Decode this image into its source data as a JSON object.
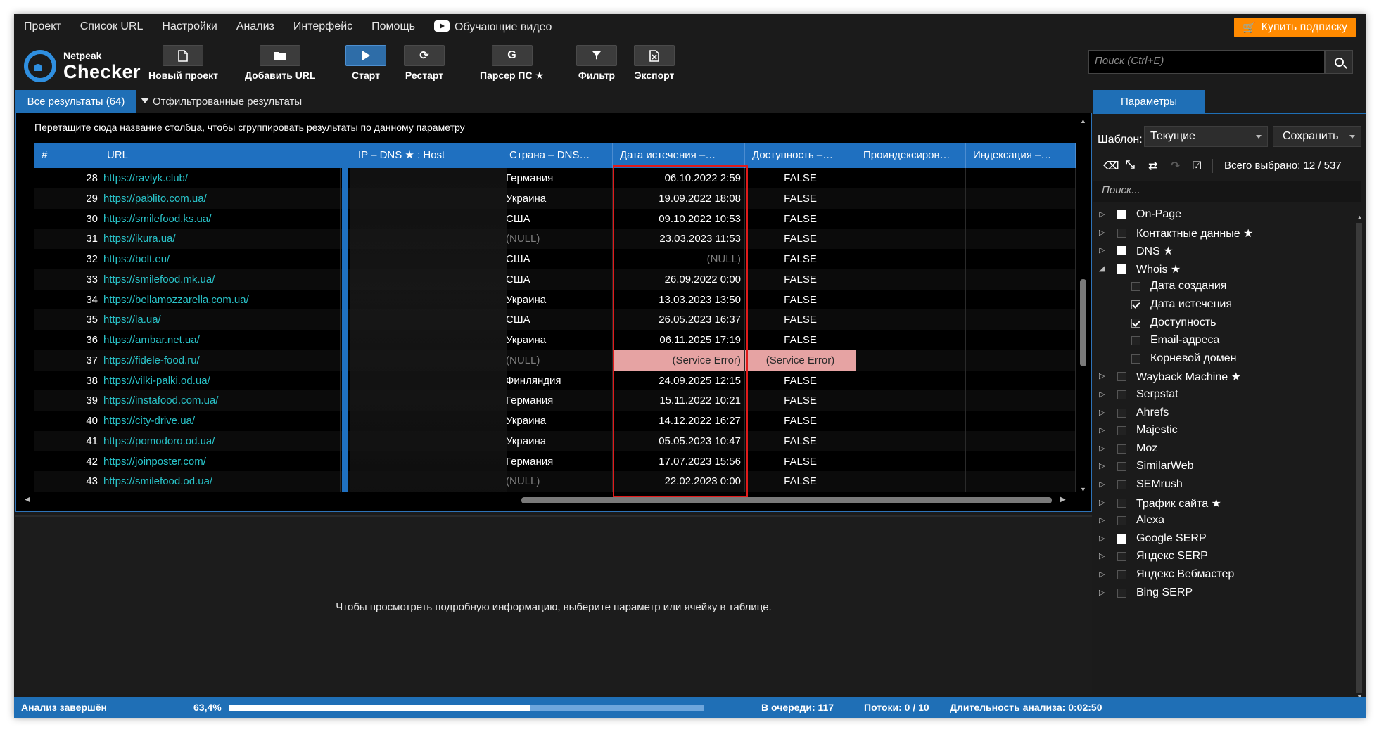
{
  "menu": [
    "Проект",
    "Список URL",
    "Настройки",
    "Анализ",
    "Интерфейс",
    "Помощь"
  ],
  "video_label": "Обучающие видео",
  "buy_label": "Купить подписку",
  "logo": {
    "line1": "Netpeak",
    "line2": "Checker"
  },
  "toolbar": {
    "new_project": "Новый проект",
    "add_url": "Добавить URL",
    "start": "Старт",
    "restart": "Рестарт",
    "parser": "Парсер ПС ★",
    "filter": "Фильтр",
    "export": "Экспорт"
  },
  "search_placeholder": "Поиск (Ctrl+E)",
  "tabs": {
    "all": "Все результаты (64)",
    "filtered": "Отфильтрованные результаты"
  },
  "group_hint": "Перетащите сюда название столбца, чтобы сгруппировать результаты по данному параметру",
  "columns": [
    "#",
    "URL",
    "IP – DNS ★ : Host",
    "Страна – DNS…",
    "Дата истечения –…",
    "Доступность –…",
    "Проиндексиров…",
    "Индексация –…"
  ],
  "rows": [
    {
      "n": "28",
      "url": "https://ravlyk.club/",
      "country": "Германия",
      "expiry": "06.10.2022 2:59",
      "avail": "FALSE"
    },
    {
      "n": "29",
      "url": "https://pablito.com.ua/",
      "country": "Украина",
      "expiry": "19.09.2022 18:08",
      "avail": "FALSE"
    },
    {
      "n": "30",
      "url": "https://smilefood.ks.ua/",
      "country": "США",
      "expiry": "09.10.2022 10:53",
      "avail": "FALSE"
    },
    {
      "n": "31",
      "url": "https://ikura.ua/",
      "country": "(NULL)",
      "expiry": "23.03.2023 11:53",
      "avail": "FALSE"
    },
    {
      "n": "32",
      "url": "https://bolt.eu/",
      "country": "США",
      "expiry": "(NULL)",
      "avail": "FALSE"
    },
    {
      "n": "33",
      "url": "https://smilefood.mk.ua/",
      "country": "США",
      "expiry": "26.09.2022 0:00",
      "avail": "FALSE"
    },
    {
      "n": "34",
      "url": "https://bellamozzarella.com.ua/",
      "country": "Украина",
      "expiry": "13.03.2023 13:50",
      "avail": "FALSE"
    },
    {
      "n": "35",
      "url": "https://la.ua/",
      "country": "США",
      "expiry": "26.05.2023 16:37",
      "avail": "FALSE"
    },
    {
      "n": "36",
      "url": "https://ambar.net.ua/",
      "country": "Украина",
      "expiry": "06.11.2025 17:19",
      "avail": "FALSE"
    },
    {
      "n": "37",
      "url": "https://fidele-food.ru/",
      "country": "(NULL)",
      "expiry": "(Service Error)",
      "avail": "(Service Error)"
    },
    {
      "n": "38",
      "url": "https://vilki-palki.od.ua/",
      "country": "Финляндия",
      "expiry": "24.09.2025 12:15",
      "avail": "FALSE"
    },
    {
      "n": "39",
      "url": "https://instafood.com.ua/",
      "country": "Германия",
      "expiry": "15.11.2022 10:21",
      "avail": "FALSE"
    },
    {
      "n": "40",
      "url": "https://city-drive.ua/",
      "country": "Украина",
      "expiry": "14.12.2022 16:27",
      "avail": "FALSE"
    },
    {
      "n": "41",
      "url": "https://pomodoro.od.ua/",
      "country": "Украина",
      "expiry": "05.05.2023 10:47",
      "avail": "FALSE"
    },
    {
      "n": "42",
      "url": "https://joinposter.com/",
      "country": "Германия",
      "expiry": "17.07.2023 15:56",
      "avail": "FALSE"
    },
    {
      "n": "43",
      "url": "https://smilefood.od.ua/",
      "country": "(NULL)",
      "expiry": "22.02.2023 0:00",
      "avail": "FALSE"
    }
  ],
  "details_text": "Чтобы просмотреть подробную информацию, выберите параметр или ячейку в таблице.",
  "params": {
    "tab": "Параметры",
    "template_label": "Шаблон:",
    "template_value": "Текущие",
    "save_label": "Сохранить",
    "total_selected": "Всего выбрано: 12 / 537",
    "search_placeholder": "Поиск...",
    "items": [
      {
        "label": "On-Page",
        "level": 0,
        "state": "partial",
        "expanded": false
      },
      {
        "label": "Контактные данные ★",
        "level": 0,
        "state": "none",
        "expanded": false
      },
      {
        "label": "DNS ★",
        "level": 0,
        "state": "partial",
        "expanded": false
      },
      {
        "label": "Whois ★",
        "level": 0,
        "state": "partial",
        "expanded": true
      },
      {
        "label": "Дата создания",
        "level": 1,
        "state": "none"
      },
      {
        "label": "Дата истечения",
        "level": 1,
        "state": "checked"
      },
      {
        "label": "Доступность",
        "level": 1,
        "state": "checked"
      },
      {
        "label": "Email-адреса",
        "level": 1,
        "state": "none"
      },
      {
        "label": "Корневой домен",
        "level": 1,
        "state": "none"
      },
      {
        "label": "Wayback Machine ★",
        "level": 0,
        "state": "none",
        "expanded": false
      },
      {
        "label": "Serpstat",
        "level": 0,
        "state": "none",
        "expanded": false
      },
      {
        "label": "Ahrefs",
        "level": 0,
        "state": "none",
        "expanded": false
      },
      {
        "label": "Majestic",
        "level": 0,
        "state": "none",
        "expanded": false
      },
      {
        "label": "Moz",
        "level": 0,
        "state": "none",
        "expanded": false
      },
      {
        "label": "SimilarWeb",
        "level": 0,
        "state": "none",
        "expanded": false
      },
      {
        "label": "SEMrush",
        "level": 0,
        "state": "none",
        "expanded": false
      },
      {
        "label": "Трафик сайта ★",
        "level": 0,
        "state": "none",
        "expanded": false
      },
      {
        "label": "Alexa",
        "level": 0,
        "state": "none",
        "expanded": false
      },
      {
        "label": "Google SERP",
        "level": 0,
        "state": "partial",
        "expanded": false
      },
      {
        "label": "Яндекс SERP",
        "level": 0,
        "state": "none",
        "expanded": false
      },
      {
        "label": "Яндекс Вебмастер",
        "level": 0,
        "state": "none",
        "expanded": false
      },
      {
        "label": "Bing SERP",
        "level": 0,
        "state": "none",
        "expanded": false
      }
    ]
  },
  "status": {
    "state": "Анализ завершён",
    "percent_text": "63,4%",
    "progress": 0.634,
    "queue": "В очереди: 117",
    "threads": "Потоки: 0 / 10",
    "duration": "Длительность анализа: 0:02:50"
  }
}
